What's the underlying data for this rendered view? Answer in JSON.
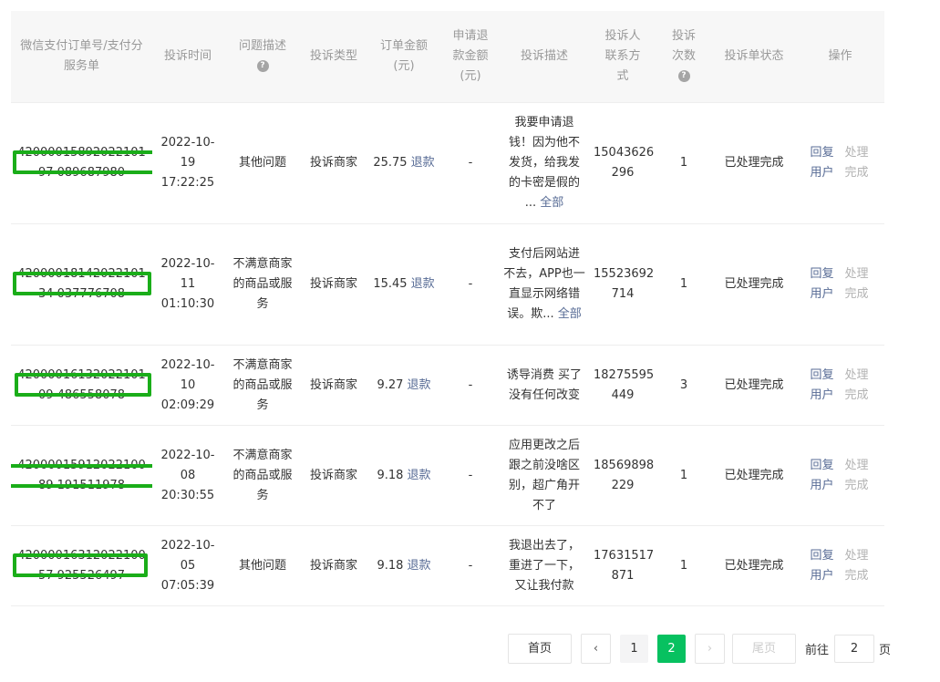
{
  "table": {
    "headers": {
      "order_no": "微信支付订单号/支付分服务单",
      "time": "投诉时间",
      "issue": "问题描述",
      "type": "投诉类型",
      "amount": "订单金额(元)",
      "refund_amount": "申请退款金额(元)",
      "desc": "投诉描述",
      "contact": "投诉人联系方式",
      "count": "投诉次数",
      "status": "投诉单状态",
      "ops": "操作"
    },
    "help_icon": "?",
    "rows": [
      {
        "order": "4200001589202210197 089687980",
        "date": "2022-10-19",
        "clock": "17:22:25",
        "issue": "其他问题",
        "type": "投诉商家",
        "amount": "25.75",
        "refund_link": "退款",
        "refund_amount": "-",
        "desc": "我要申请退钱！因为他不发货，给我发的卡密是假的 ...",
        "desc_more": "全部",
        "phone_a": "15043626",
        "phone_b": "296",
        "count": "1",
        "status": "已处理完成",
        "reply_label": "回复用户",
        "done_label": "处理完成"
      },
      {
        "order": "4200001814202210134 037776708",
        "date": "2022-10-11",
        "clock": "01:10:30",
        "issue": "不满意商家的商品或服务",
        "type": "投诉商家",
        "amount": "15.45",
        "refund_link": "退款",
        "refund_amount": "-",
        "desc": "支付后网站进不去，APP也一直显示网络错误。欺...",
        "desc_more": "全部",
        "phone_a": "15523692",
        "phone_b": "714",
        "count": "1",
        "status": "已处理完成",
        "reply_label": "回复用户",
        "done_label": "处理完成"
      },
      {
        "order": "4200001613202210109 486558078",
        "date": "2022-10-10",
        "clock": "02:09:29",
        "issue": "不满意商家的商品或服务",
        "type": "投诉商家",
        "amount": "9.27",
        "refund_link": "退款",
        "refund_amount": "-",
        "desc": "诱导消费 买了没有任何改变",
        "desc_more": "",
        "phone_a": "18275595",
        "phone_b": "449",
        "count": "3",
        "status": "已处理完成",
        "reply_label": "回复用户",
        "done_label": "处理完成"
      },
      {
        "order": "4200001591202210089 191511978",
        "date": "2022-10-08",
        "clock": "20:30:55",
        "issue": "不满意商家的商品或服务",
        "type": "投诉商家",
        "amount": "9.18",
        "refund_link": "退款",
        "refund_amount": "-",
        "desc": "应用更改之后跟之前没啥区别，超广角开不了",
        "desc_more": "",
        "phone_a": "18569898",
        "phone_b": "229",
        "count": "1",
        "status": "已处理完成",
        "reply_label": "回复用户",
        "done_label": "处理完成"
      },
      {
        "order": "4200001631202210057 925526497",
        "date": "2022-10-05",
        "clock": "07:05:39",
        "issue": "其他问题",
        "type": "投诉商家",
        "amount": "9.18",
        "refund_link": "退款",
        "refund_amount": "-",
        "desc": "我退出去了，重进了一下，又让我付款",
        "desc_more": "",
        "phone_a": "17631517",
        "phone_b": "871",
        "count": "1",
        "status": "已处理完成",
        "reply_label": "回复用户",
        "done_label": "处理完成"
      }
    ]
  },
  "colors": {
    "header_bg": "#f7f7f7",
    "link": "#576b95",
    "brand_green": "#07c160",
    "redaction_green": "#1aad19"
  },
  "pagination": {
    "first_label": "首页",
    "prev_icon": "chevron-left-icon",
    "prev_glyph": "‹",
    "pages": [
      "1",
      "2"
    ],
    "current_page": "2",
    "next_icon": "chevron-right-icon",
    "next_glyph": "›",
    "last_label": "尾页",
    "goto_label": "前往",
    "goto_value": "2",
    "goto_suffix": "页"
  }
}
